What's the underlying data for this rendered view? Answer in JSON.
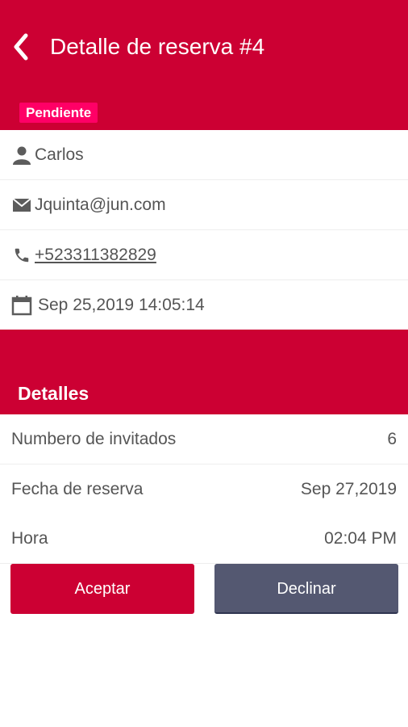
{
  "header": {
    "title": "Detalle de reserva #4",
    "status_badge": "Pendiente"
  },
  "contact": {
    "name": "Carlos",
    "email": "Jquinta@jun.com",
    "phone": "+523311382829",
    "datetime": "Sep 25,2019 14:05:14"
  },
  "details": {
    "section_title": "Detalles",
    "rows": [
      {
        "label": "Numbero de invitados",
        "value": "6"
      },
      {
        "label": "Fecha de reserva",
        "value": "Sep 27,2019"
      },
      {
        "label": "Hora",
        "value": "02:04 PM"
      }
    ]
  },
  "actions": {
    "accept_label": "Aceptar",
    "decline_label": "Declinar"
  },
  "colors": {
    "primary": "#cc0033",
    "badge": "#ff0066",
    "decline": "#545871",
    "text": "#555555"
  },
  "icons": [
    "back-arrow-icon",
    "person-icon",
    "envelope-icon",
    "phone-icon",
    "calendar-icon"
  ]
}
